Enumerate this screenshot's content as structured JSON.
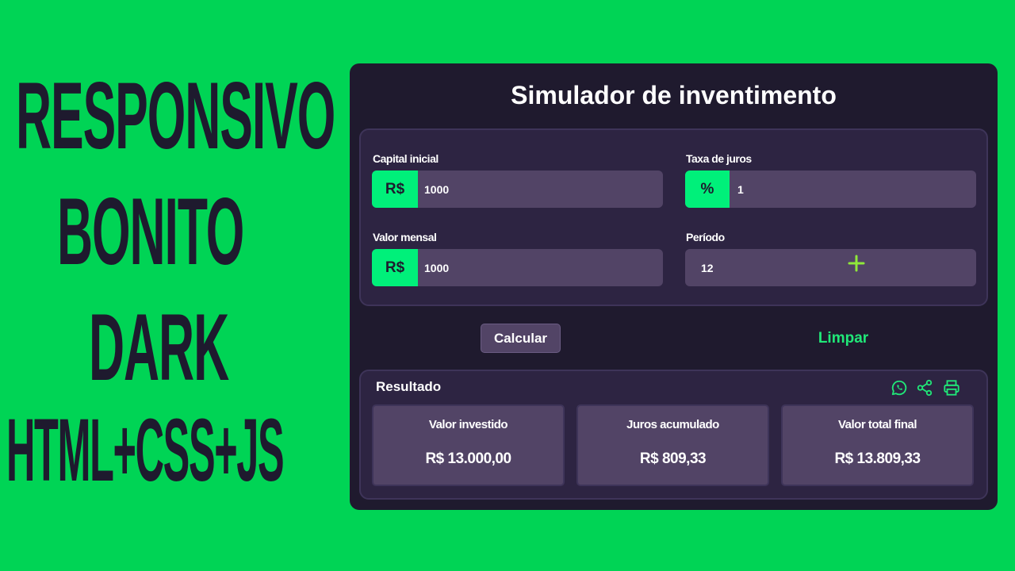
{
  "headline": {
    "line1": "RESPONSIVO",
    "line2": "BONITO",
    "line3": "DARK",
    "line4": "HTML+CSS+JS"
  },
  "app": {
    "title": "Simulador de inventimento",
    "fields": {
      "capital": {
        "label": "Capital inicial",
        "prefix": "R$",
        "value": "1000"
      },
      "taxa": {
        "label": "Taxa de juros",
        "prefix": "%",
        "value": "1"
      },
      "mensal": {
        "label": "Valor mensal",
        "prefix": "R$",
        "value": "1000"
      },
      "periodo": {
        "label": "Período",
        "value": "12"
      }
    },
    "buttons": {
      "calculate": "Calcular",
      "clear": "Limpar"
    },
    "result": {
      "title": "Resultado",
      "cards": [
        {
          "label": "Valor investido",
          "value": "R$ 13.000,00"
        },
        {
          "label": "Juros acumulado",
          "value": "R$ 809,33"
        },
        {
          "label": "Valor total final",
          "value": "R$ 13.809,33"
        }
      ],
      "icons": [
        "whatsapp-icon",
        "share-icon",
        "print-icon"
      ]
    }
  },
  "colors": {
    "background": "#00d455",
    "panel": "#1f1a2e",
    "accent": "#00f07a",
    "input": "#524466"
  }
}
